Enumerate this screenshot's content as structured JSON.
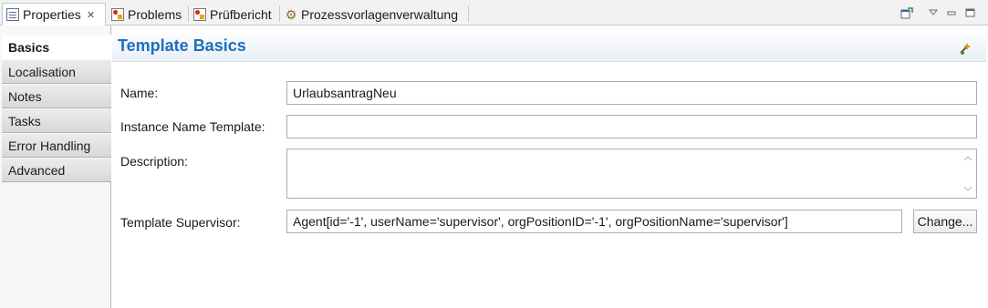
{
  "tabs": [
    {
      "label": "Properties",
      "icon": "properties-icon",
      "active": true,
      "closable": true
    },
    {
      "label": "Problems",
      "icon": "problems-icon"
    },
    {
      "label": "Prüfbericht",
      "icon": "report-icon"
    },
    {
      "label": "Prozessvorlagenverwaltung",
      "icon": "gear-icon"
    }
  ],
  "nav": {
    "items": [
      "Basics",
      "Localisation",
      "Notes",
      "Tasks",
      "Error Handling",
      "Advanced"
    ],
    "selected": "Basics"
  },
  "header": {
    "title": "Template Basics"
  },
  "form": {
    "name_label": "Name:",
    "name_value": "UrlaubsantragNeu",
    "instance_label": "Instance Name Template:",
    "instance_value": "",
    "description_label": "Description:",
    "description_value": "",
    "supervisor_label": "Template Supervisor:",
    "supervisor_value": "Agent[id='-1', userName='supervisor', orgPositionID='-1', orgPositionName='supervisor']",
    "change_button": "Change..."
  },
  "colors": {
    "accent": "#1b6fbe",
    "header_gradient_end": "#e9eff6"
  }
}
